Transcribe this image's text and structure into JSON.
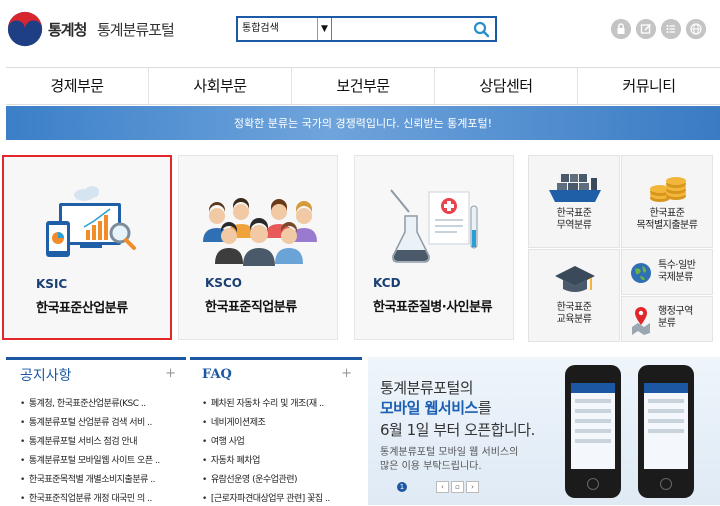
{
  "header": {
    "logo_text": "통계청",
    "portal_title": "통계분류포털",
    "search": {
      "scope_value": "통합검색",
      "input_value": "",
      "placeholder": ""
    }
  },
  "top_icons": [
    "lock-icon",
    "edit-icon",
    "list-icon",
    "globe-icon"
  ],
  "nav": {
    "items": [
      {
        "label": "경제부문"
      },
      {
        "label": "사회부문"
      },
      {
        "label": "보건부문"
      },
      {
        "label": "상담센터"
      },
      {
        "label": "커뮤니티"
      }
    ]
  },
  "banner": {
    "text": "정확한 분류는 국가의 경쟁력입니다. 신뢰받는 통계포털!"
  },
  "cards": [
    {
      "code": "KSIC",
      "name": "한국표준산업분류"
    },
    {
      "code": "KSCO",
      "name": "한국표준직업분류"
    },
    {
      "code": "KCD",
      "name": "한국표준질병·사인분류"
    }
  ],
  "mini_cards": [
    {
      "line1": "한국표준",
      "line2": "무역분류"
    },
    {
      "line1": "한국표준",
      "line2": "목적별지출분류"
    },
    {
      "line1": "한국표준",
      "line2": "교육분류"
    },
    {
      "line1": "특수·일반",
      "line2": "국제분류"
    },
    {
      "line1": "행정구역",
      "line2": "분류"
    }
  ],
  "notice": {
    "title": "공지사항",
    "more": "+",
    "items": [
      "통계청, 한국표준산업분류(KSC ..",
      "통계분류포털 산업분류 검색 서비 ..",
      "통계분류포털 서비스 점검 안내",
      "통계분류포털 모바일웹 사이트 오픈 ..",
      "한국표준목적별 개별소비지출분류 ..",
      "한국표준직업분류 개정 대국민 의 .."
    ]
  },
  "faq": {
    "title": "FAQ",
    "more": "+",
    "items": [
      "폐차된 자동차 수리 및 개조(재 ..",
      "네비게이션제조",
      "여행 사업",
      "자동차 폐차업",
      "유람선운영 (운수업관련)",
      "[근로자파견대상업무 관련] 꽃집 .."
    ]
  },
  "promo": {
    "line1": "통계분류포털의",
    "line2_highlight": "모바일 웹서비스",
    "line2_suffix": "를",
    "line3": "6월 1일 부터 오픈합니다.",
    "sub1": "통계분류포털 모바일 웹 서비스의",
    "sub2": "많은 이용 부탁드립니다.",
    "page": "1",
    "controls": [
      "‹",
      "▫",
      "›"
    ]
  },
  "colors": {
    "brand_blue": "#1c57a3",
    "highlight_red": "#e2262a",
    "banner_blue": "#3b7fc8"
  }
}
